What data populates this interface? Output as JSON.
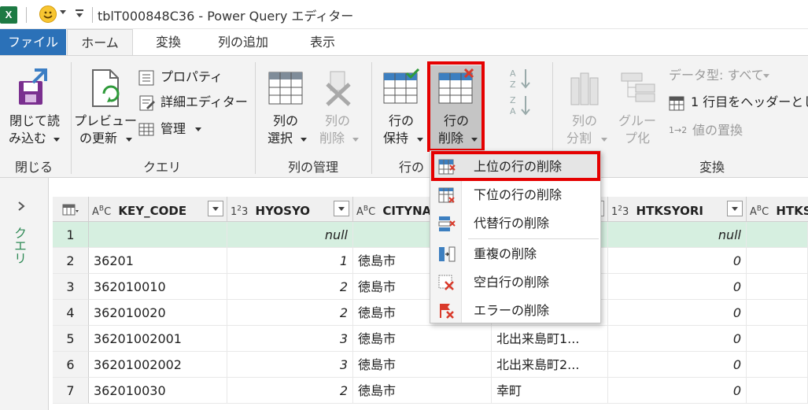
{
  "titlebar": {
    "title": "tblT000848C36 - Power Query エディター",
    "excel_icon": "excel-icon",
    "smiley_icon": "smiley-icon"
  },
  "menubar": {
    "tabs": [
      "ファイル",
      "ホーム",
      "変換",
      "列の追加",
      "表示"
    ],
    "active": "ホーム"
  },
  "ribbon": {
    "close": {
      "line1": "閉じて読",
      "line2": "み込む",
      "group": "閉じる"
    },
    "query": {
      "preview_line1": "プレビュー",
      "preview_line2": "の更新",
      "properties": "プロパティ",
      "advanced_editor": "詳細エディター",
      "manage": "管理",
      "group": "クエリ"
    },
    "columns": {
      "select_line1": "列の",
      "select_line2": "選択",
      "delete_line1": "列の",
      "delete_line2": "削除",
      "group": "列の管理"
    },
    "rows": {
      "keep_line1": "行の",
      "keep_line2": "保持",
      "delete_line1": "行の",
      "delete_line2": "削除",
      "group": "行の"
    },
    "sort": {
      "asc_icon": "sort-ascending-icon",
      "desc_icon": "sort-descending-icon"
    },
    "transform": {
      "split_line1": "列の",
      "split_line2": "分割",
      "group_line1": "グルー",
      "group_line2": "プ化",
      "data_type": "データ型: すべて",
      "use_first_row": "1 行目をヘッダーとし",
      "replace_values": "値の置換",
      "replace_prefix": "1→2",
      "group": "変換"
    }
  },
  "sidebar": {
    "label": "クエリ"
  },
  "grid": {
    "columns": [
      {
        "type": "ABC",
        "name": "KEY_CODE"
      },
      {
        "type": "123",
        "name": "HYOSYO"
      },
      {
        "type": "ABC",
        "name": "CITYNA"
      },
      {
        "type": "ABC",
        "name": ""
      },
      {
        "type": "123",
        "name": "HTKSYORI"
      },
      {
        "type": "ABC",
        "name": "HTKS"
      }
    ],
    "rows": [
      {
        "n": "1",
        "key": "",
        "hyo": "null",
        "city": "",
        "name": "",
        "htk": "null"
      },
      {
        "n": "2",
        "key": "36201",
        "hyo": "1",
        "city": "徳島市",
        "name": "",
        "htk": "0"
      },
      {
        "n": "3",
        "key": "362010010",
        "hyo": "2",
        "city": "徳島市",
        "name": "",
        "htk": "0"
      },
      {
        "n": "4",
        "key": "362010020",
        "hyo": "2",
        "city": "徳島市",
        "name": "",
        "htk": "0"
      },
      {
        "n": "5",
        "key": "36201002001",
        "hyo": "3",
        "city": "徳島市",
        "name": "北出来島町1...",
        "htk": "0"
      },
      {
        "n": "6",
        "key": "36201002002",
        "hyo": "3",
        "city": "徳島市",
        "name": "北出来島町2...",
        "htk": "0"
      },
      {
        "n": "7",
        "key": "362010030",
        "hyo": "2",
        "city": "徳島市",
        "name": "幸町",
        "htk": "0"
      }
    ]
  },
  "dropdown": {
    "items": [
      "上位の行の削除",
      "下位の行の削除",
      "代替行の削除",
      "重複の削除",
      "空白行の削除",
      "エラーの削除"
    ],
    "highlighted": "上位の行の削除"
  },
  "colors": {
    "highlight_red": "#e50000",
    "file_tab": "#2b71b8",
    "row_highlight": "#d6efe0"
  }
}
